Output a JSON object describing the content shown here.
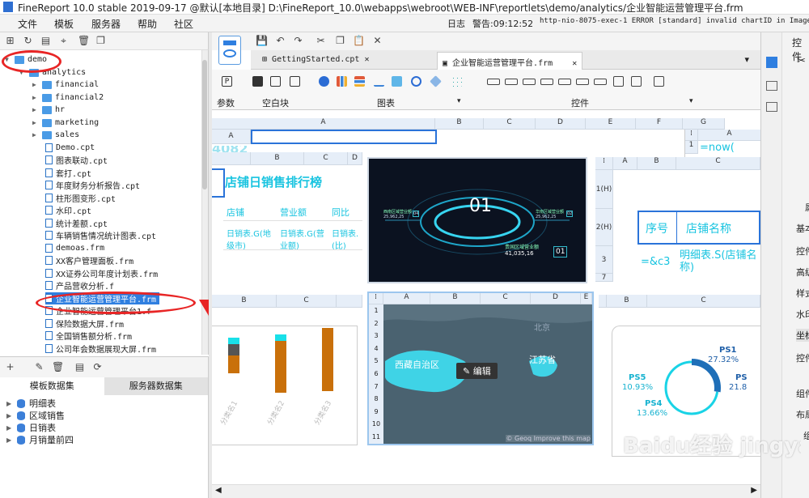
{
  "window": {
    "title": "FineReport 10.0 stable 2019-09-17 @默认[本地目录]    D:\\FineReport_10.0\\webapps\\webroot\\WEB-INF\\reportlets\\demo/analytics/企业智能运营管理平台.frm"
  },
  "menubar": {
    "items": [
      "文件",
      "模板",
      "服务器",
      "帮助",
      "社区"
    ],
    "log_label": "日志",
    "warn_label": "警告:09:12:52",
    "log_text": "http-nio-8075-exec-1 ERROR [standard] invalid chartID in ImageToJ"
  },
  "tree": {
    "root": "demo",
    "folder": "analytics",
    "subfolders": [
      "financial",
      "financial2",
      "hr",
      "marketing",
      "sales"
    ],
    "files": [
      "Demo.cpt",
      "图表联动.cpt",
      "套打.cpt",
      "年度财务分析报告.cpt",
      "柱形图变形.cpt",
      "水印.cpt",
      "统计差额.cpt",
      "车辆销售情况统计图表.cpt",
      "demoas.frm",
      "XX客户管理面板.frm",
      "XX证券公司年度计划表.frm",
      "产品营收分析.f",
      "企业智能运营管理平台.frm",
      "企业智能运营管理平台1.f",
      "保险数据大屏.frm",
      "全国销售额分析.frm",
      "公司年会数据展现大屏.frm"
    ],
    "selected": "企业智能运营管理平台.frm"
  },
  "datasets": {
    "tab_template": "模板数据集",
    "tab_server": "服务器数据集",
    "items": [
      "明细表",
      "区域销售",
      "日销表",
      "月销量前四"
    ]
  },
  "doctabs": [
    "GettingStarted.cpt",
    "企业智能运营管理平台.frm"
  ],
  "ribbon": {
    "param": "参数",
    "blank": "空白块",
    "chart": "图表",
    "control": "控件"
  },
  "canvas": {
    "main_cols": [
      "A",
      "B",
      "C",
      "D",
      "E",
      "F",
      "G"
    ],
    "row_label": "A",
    "partial_number": "4082",
    "col_a2": "A",
    "row_1": "1",
    "now_formula": "=now(",
    "rank": {
      "cols": [
        "B",
        "C",
        "D"
      ],
      "title": "店铺日销售排行榜",
      "h1": "店铺",
      "h2": "营业额",
      "h3": "同比",
      "c1": "日销表.G(地级市)",
      "c2": "日销表.G(营业额)",
      "c3": "日销表.(比)"
    },
    "dark": {
      "center": "01",
      "label_l": "西南区域营业额",
      "value_l": "25,962,25",
      "label_r": "华南区域营业额",
      "value_r": "25,962,25",
      "label_b": "贵国区域营业额",
      "value_b": "41,035,16",
      "badge_b": "01",
      "badge_l": "04",
      "badge_r": "02"
    },
    "table2": {
      "cols": [
        "A",
        "B",
        "C"
      ],
      "rows": [
        "1(H)",
        "2(H)",
        "3",
        "7"
      ],
      "h1": "序号",
      "h2": "店铺名称",
      "f1": "=&c3",
      "f2": "明细表.S(店铺名称)"
    },
    "bars": {
      "cols": [
        "B",
        "C"
      ],
      "labels": [
        "分类名1",
        "分类名2",
        "分类名3"
      ]
    },
    "map": {
      "cols": [
        "A",
        "B",
        "C",
        "D",
        "E"
      ],
      "rows": [
        "1",
        "2",
        "3",
        "4",
        "5",
        "6",
        "7",
        "8",
        "9",
        "10",
        "11"
      ],
      "label_w": "西藏自治区",
      "label_e": "江苏省",
      "label_n": "北京",
      "edit": "编辑",
      "credit": "© Geoq Improve this map"
    },
    "pie": {
      "cols": [
        "B",
        "C"
      ],
      "ps1": "PS1",
      "ps1v": "27.32%",
      "ps5": "PS5",
      "ps5v": "10.93%",
      "ps4": "PS4",
      "ps4v": "13.66%",
      "ps3": "PS",
      "ps3v": "21.8"
    }
  },
  "rightpanel": {
    "top": "控件",
    "items": [
      "基本",
      "控件",
      "高级",
      "样式",
      "水印",
      "坐标",
      "控件",
      "组件",
      "布局",
      "组"
    ],
    "side": "属"
  },
  "watermark": "Baidu经验 jingyan.baidu.com"
}
